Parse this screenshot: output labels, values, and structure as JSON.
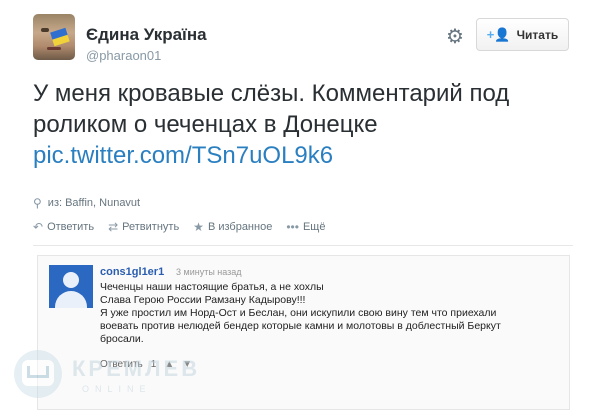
{
  "header": {
    "full_name": "Єдина Україна",
    "handle": "@pharaon01",
    "follow_label": "Читать"
  },
  "tweet": {
    "text": "У меня кровавые слёзы. Комментарий под роликом о чеченцах в Донецке",
    "link": "pic.twitter.com/TSn7uOL9k6",
    "location": "из: Baffin, Nunavut"
  },
  "actions": {
    "reply": "Ответить",
    "retweet": "Ретвитнуть",
    "favorite": "В избранное",
    "more": "Ещё"
  },
  "comment": {
    "author": "cons1gl1er1",
    "time": "3 минуты назад",
    "lines": [
      "Чеченцы наши настоящие братья, а не хохлы",
      "Слава Герою России Рамзану Кадырову!!!",
      "Я уже простил им Норд-Ост и Беслан, они искупили свою вину тем что приехали",
      "воевать против нелюдей бендер которые камни и молотовы в доблестный Беркут",
      "бросали."
    ],
    "footer": {
      "reply": "Ответить",
      "likes": "1"
    }
  },
  "watermark": {
    "text": "КРЕМЛЕВ",
    "sub": "ONLINE"
  },
  "icons": {
    "gear": "gear-icon",
    "follow": "add-user-icon",
    "pin": "location-pin-icon",
    "reply": "reply-icon",
    "retweet": "retweet-icon",
    "favorite": "star-icon",
    "more": "more-dots-icon"
  },
  "colors": {
    "link": "#2a7fc1",
    "comment_author": "#2a5db0",
    "comment_avatar": "#2b68c2"
  }
}
